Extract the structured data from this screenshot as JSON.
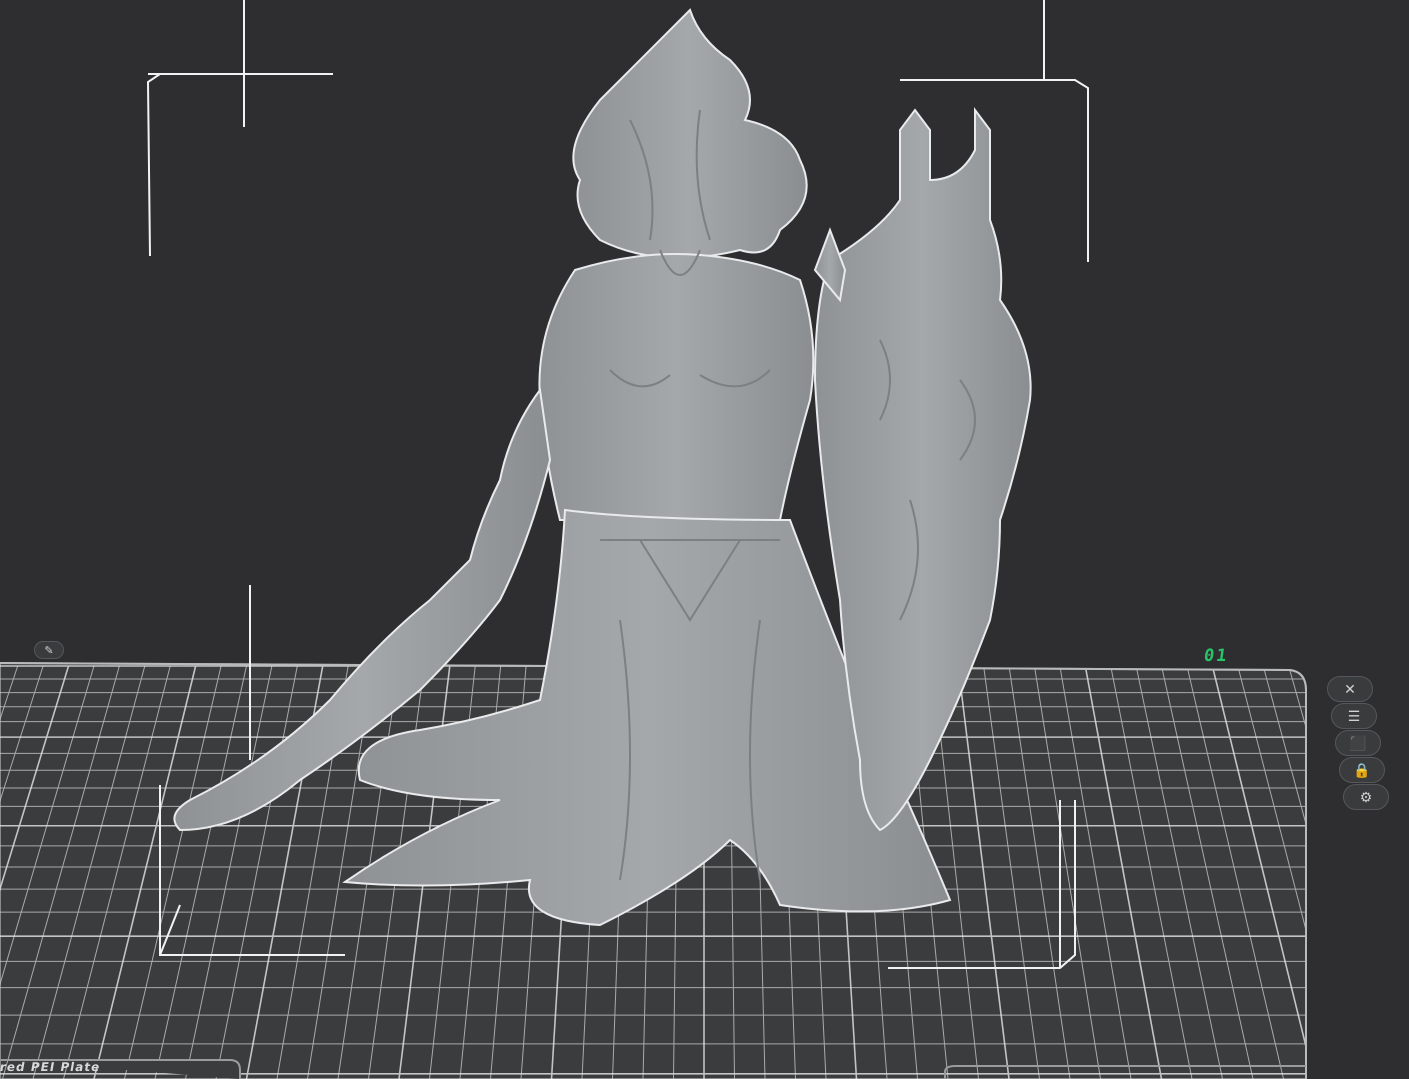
{
  "plate": {
    "number": "01",
    "label": "red PEI Plate"
  },
  "plate_buttons": [
    {
      "name": "close-icon",
      "glyph": "✕"
    },
    {
      "name": "arrange-icon",
      "glyph": "☰"
    },
    {
      "name": "auto-orient-icon",
      "glyph": "⬛"
    },
    {
      "name": "lock-icon",
      "glyph": "🔒"
    },
    {
      "name": "settings-icon",
      "glyph": "⚙"
    }
  ],
  "colors": {
    "background": "#2e2e30",
    "plate_grid": "#d0d0d0",
    "model": "#9fa3a6",
    "bounding_box": "#ffffff",
    "plate_accent": "#27c46a"
  }
}
